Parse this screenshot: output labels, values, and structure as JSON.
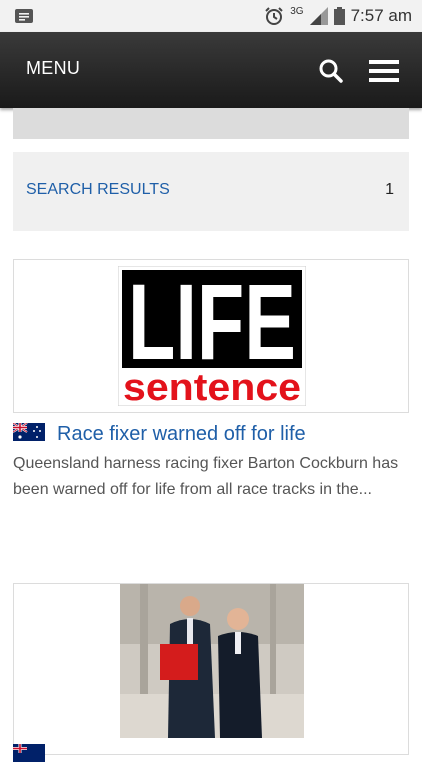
{
  "status_bar": {
    "network": "3G",
    "time": "7:57 am"
  },
  "header": {
    "menu_label": "MENU",
    "icons": [
      "search-icon",
      "hamburger-icon"
    ]
  },
  "search_results": {
    "label": "SEARCH RESULTS",
    "count": "1"
  },
  "articles": [
    {
      "image_text_top": "LIFE",
      "image_text_bottom": "sentence",
      "flag": "australia-flag-icon",
      "title": "Race fixer warned off for life",
      "excerpt": "Queensland harness racing fixer Barton Cockburn has been warned off for life from all race tracks in the..."
    },
    {
      "flag": "australia-flag-icon"
    }
  ],
  "colors": {
    "link": "#1f5fa8",
    "header_bg": "#2a2a2a",
    "image_red": "#e3121b"
  }
}
